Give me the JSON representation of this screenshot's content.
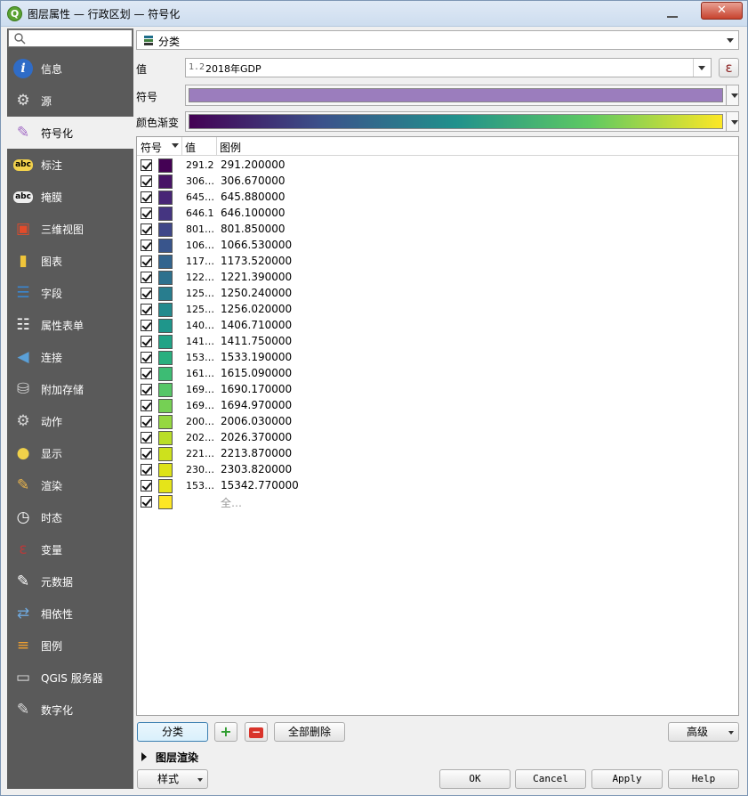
{
  "window": {
    "title": "图层属性 — 行政区划 — 符号化"
  },
  "sidebar": {
    "items": [
      {
        "label": "信息",
        "icon": "info-icon"
      },
      {
        "label": "源",
        "icon": "source-icon"
      },
      {
        "label": "符号化",
        "icon": "symbology-icon"
      },
      {
        "label": "标注",
        "icon": "labels-icon"
      },
      {
        "label": "掩膜",
        "icon": "mask-icon"
      },
      {
        "label": "三维视图",
        "icon": "3d-view-icon"
      },
      {
        "label": "图表",
        "icon": "diagram-icon"
      },
      {
        "label": "字段",
        "icon": "fields-icon"
      },
      {
        "label": "属性表单",
        "icon": "attributes-form-icon"
      },
      {
        "label": "连接",
        "icon": "joins-icon"
      },
      {
        "label": "附加存储",
        "icon": "auxiliary-storage-icon"
      },
      {
        "label": "动作",
        "icon": "actions-icon"
      },
      {
        "label": "显示",
        "icon": "display-icon"
      },
      {
        "label": "渲染",
        "icon": "rendering-icon"
      },
      {
        "label": "时态",
        "icon": "temporal-icon"
      },
      {
        "label": "变量",
        "icon": "variables-icon"
      },
      {
        "label": "元数据",
        "icon": "metadata-icon"
      },
      {
        "label": "相依性",
        "icon": "dependencies-icon"
      },
      {
        "label": "图例",
        "icon": "legend-icon"
      },
      {
        "label": "QGIS 服务器",
        "icon": "qgis-server-icon"
      },
      {
        "label": "数字化",
        "icon": "digitizing-icon"
      }
    ],
    "selected": "符号化"
  },
  "renderer": {
    "type": "分类"
  },
  "value": {
    "label": "值",
    "type_badge": "1.2",
    "field": "2018年GDP",
    "expr_glyph": "ε"
  },
  "symbol": {
    "label": "符号",
    "color": "#9b7dbd"
  },
  "ramp": {
    "label": "颜色渐变"
  },
  "table": {
    "headers": {
      "symbol": "符号",
      "value": "值",
      "legend": "图例"
    },
    "rows": [
      {
        "value": "291.2",
        "legend": "291.200000",
        "color": "#440154"
      },
      {
        "value": "306…",
        "legend": "306.670000",
        "color": "#481467"
      },
      {
        "value": "645…",
        "legend": "645.880000",
        "color": "#482576"
      },
      {
        "value": "646.1",
        "legend": "646.100000",
        "color": "#453581"
      },
      {
        "value": "801…",
        "legend": "801.850000",
        "color": "#3f4788"
      },
      {
        "value": "106…",
        "legend": "1066.530000",
        "color": "#39558c"
      },
      {
        "value": "117…",
        "legend": "1173.520000",
        "color": "#32648e"
      },
      {
        "value": "122…",
        "legend": "1221.390000",
        "color": "#2d718e"
      },
      {
        "value": "125…",
        "legend": "1250.240000",
        "color": "#287d8e"
      },
      {
        "value": "125…",
        "legend": "1256.020000",
        "color": "#238a8d"
      },
      {
        "value": "140…",
        "legend": "1406.710000",
        "color": "#1f968b"
      },
      {
        "value": "141…",
        "legend": "1411.750000",
        "color": "#20a386"
      },
      {
        "value": "153…",
        "legend": "1533.190000",
        "color": "#29af7f"
      },
      {
        "value": "161…",
        "legend": "1615.090000",
        "color": "#3dbc74"
      },
      {
        "value": "169…",
        "legend": "1690.170000",
        "color": "#56c667"
      },
      {
        "value": "169…",
        "legend": "1694.970000",
        "color": "#75d054"
      },
      {
        "value": "200…",
        "legend": "2006.030000",
        "color": "#95d840"
      },
      {
        "value": "202…",
        "legend": "2026.370000",
        "color": "#bade28"
      },
      {
        "value": "221…",
        "legend": "2213.870000",
        "color": "#cde11d"
      },
      {
        "value": "230…",
        "legend": "2303.820000",
        "color": "#dde318"
      },
      {
        "value": "153…",
        "legend": "15342.770000",
        "color": "#e5e419"
      },
      {
        "value": "",
        "legend": "全…",
        "color": "#fde725"
      }
    ]
  },
  "buttons": {
    "classify": "分类",
    "add": "+",
    "remove": "−",
    "delete_all": "全部删除",
    "advanced": "高级",
    "layer_rendering": "图层渲染",
    "style": "样式",
    "ok": "OK",
    "cancel": "Cancel",
    "apply": "Apply",
    "help": "Help"
  }
}
